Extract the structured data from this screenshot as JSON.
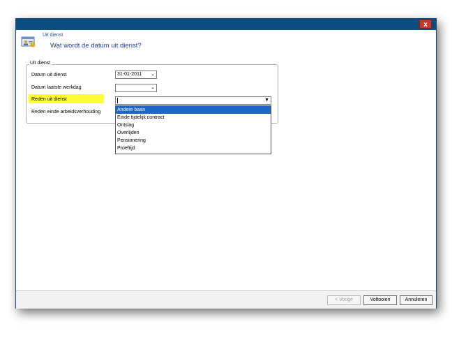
{
  "window": {
    "close_symbol": "x"
  },
  "header": {
    "section_title": "Uit dienst",
    "question": "Wat wordt de datum uit dienst?",
    "icon": "user-card-icon"
  },
  "group": {
    "label": "Uit dienst"
  },
  "fields": {
    "datum_uit_dienst": {
      "label": "Datum uit dienst",
      "value": "31-01-2011"
    },
    "datum_laatste_werkdag": {
      "label": "Datum laatste werkdag",
      "value": ""
    },
    "reden_uit_dienst": {
      "label": "Reden uit dienst",
      "value": ""
    },
    "reden_einde": {
      "label": "Reden einde arbeidsverhouding"
    }
  },
  "dropdown": {
    "options": [
      {
        "label": "Andere baan",
        "selected": true
      },
      {
        "label": "Einde tijdelijk contract",
        "selected": false
      },
      {
        "label": "Ontslag",
        "selected": false
      },
      {
        "label": "Overlijden",
        "selected": false
      },
      {
        "label": "Pensionering",
        "selected": false
      },
      {
        "label": "Proeftijd",
        "selected": false
      }
    ]
  },
  "footer": {
    "prev_label": "< Vorige",
    "finish_label": "Voltooien",
    "cancel_label": "Annuleren"
  },
  "colors": {
    "titlebar": "#0f4d80",
    "highlight": "#ffff33",
    "selection": "#1e66c8",
    "heading": "#1a38c8"
  }
}
